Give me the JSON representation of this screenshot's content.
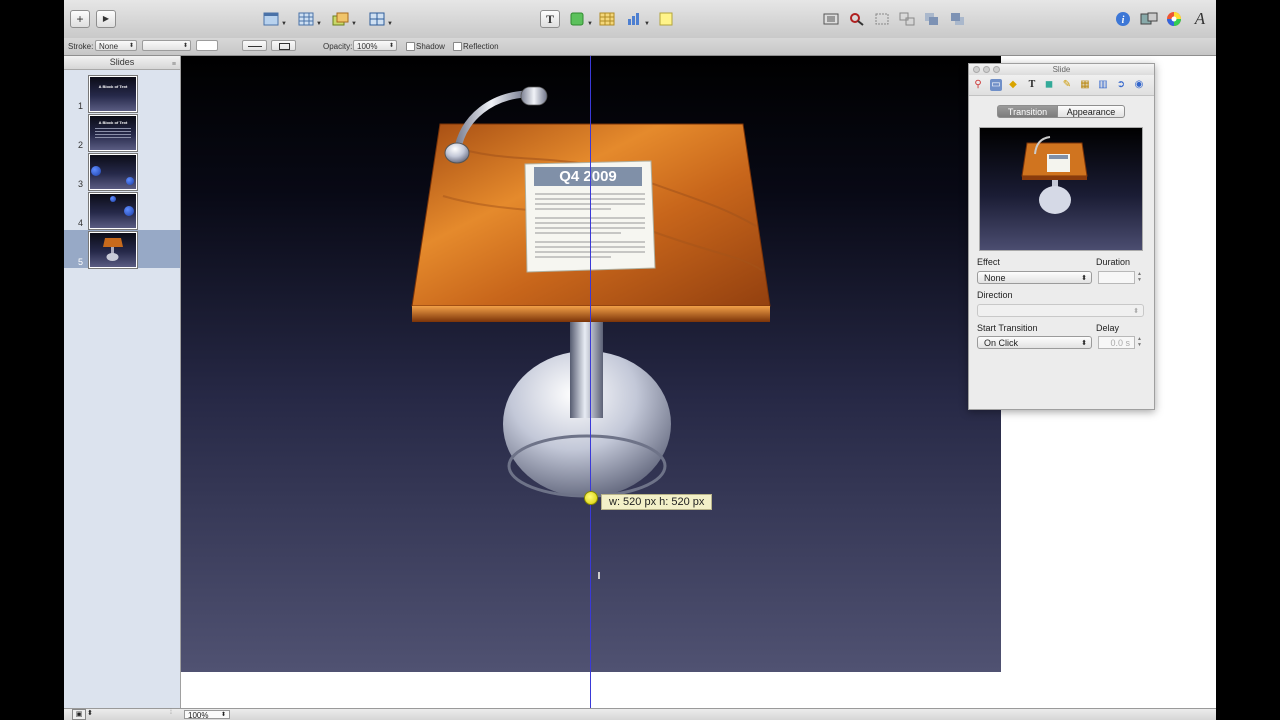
{
  "sidebar": {
    "header": "Slides",
    "slides": [
      {
        "num": "1",
        "title": "A Block of Text"
      },
      {
        "num": "2",
        "title": "A Block of Text"
      },
      {
        "num": "3",
        "title": ""
      },
      {
        "num": "4",
        "title": ""
      },
      {
        "num": "5",
        "title": ""
      }
    ],
    "selected_index": 5
  },
  "formatbar": {
    "stroke_label": "Stroke:",
    "stroke_value": "None",
    "opacity_label": "Opacity:",
    "opacity_value": "100%",
    "shadow_label": "Shadow",
    "reflection_label": "Reflection"
  },
  "canvas": {
    "podium_note_title": "Q4 2009",
    "size_tooltip": "w: 520 px   h: 520 px"
  },
  "inspector": {
    "window_title": "Slide",
    "tabs": [
      {
        "label": "Transition",
        "active": true
      },
      {
        "label": "Appearance",
        "active": false
      }
    ],
    "effect_label": "Effect",
    "effect_value": "None",
    "duration_label": "Duration",
    "duration_value": "",
    "direction_label": "Direction",
    "direction_value": "",
    "start_label": "Start Transition",
    "start_value": "On Click",
    "delay_label": "Delay",
    "delay_value": "0.0 s"
  },
  "bottombar": {
    "zoom_value": "100%"
  },
  "colors": {
    "selection": "#97a9c6",
    "guide": "#3a39d8",
    "tooltip_bg": "#f3f0c8"
  },
  "icons": [
    "plus-icon",
    "play-icon",
    "view-icon",
    "table-icon",
    "masters-icon",
    "text-box-icon",
    "shapes-icon",
    "chart-icon",
    "comment-icon",
    "mask-icon",
    "alpha-icon",
    "front-icon",
    "back-icon",
    "inspector-icon",
    "media-icon",
    "colors-icon",
    "fonts-icon"
  ]
}
